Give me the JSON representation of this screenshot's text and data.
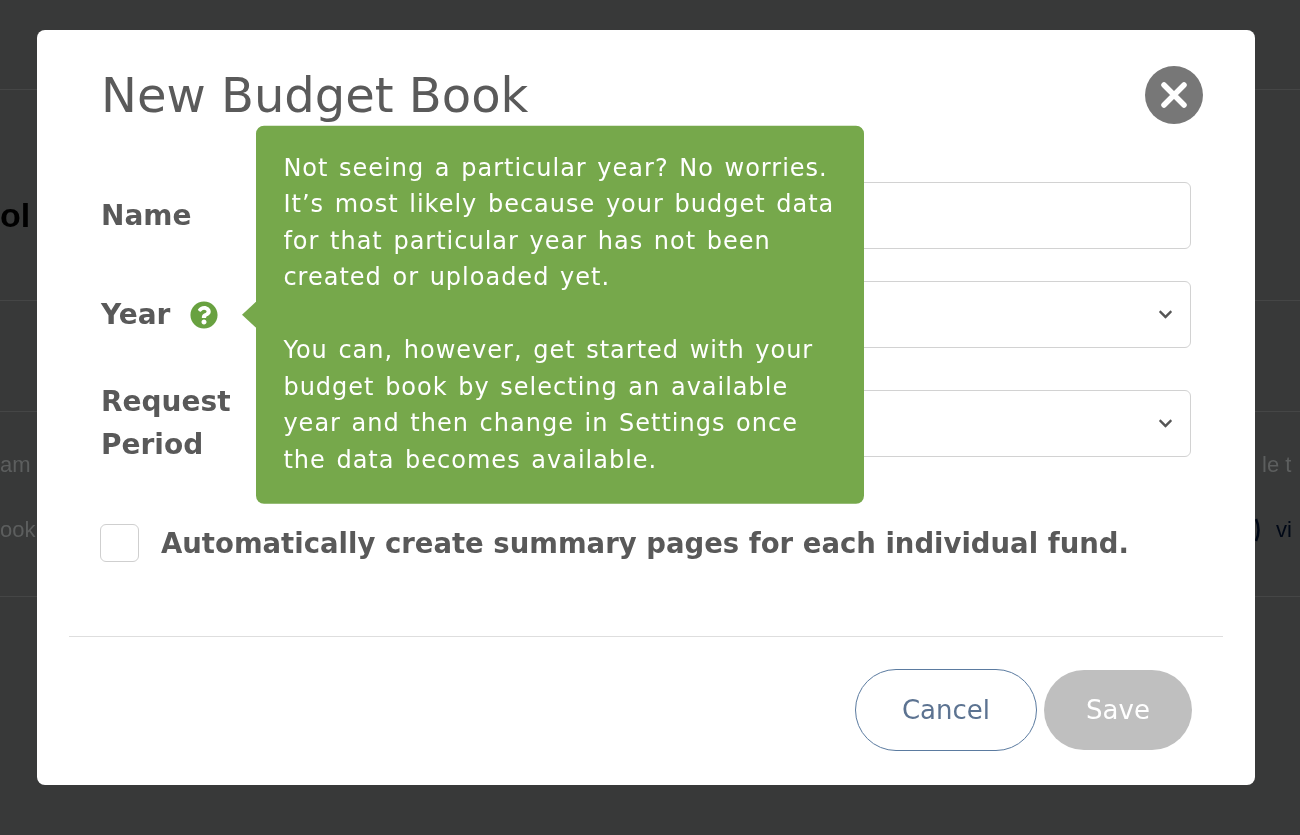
{
  "background_page": {
    "heading_fragment": "ol",
    "left_fragments": [
      "am",
      "ook"
    ],
    "right_fragments": [
      "le t",
      "vi"
    ]
  },
  "dialog": {
    "title": "New Budget Book",
    "fields": [
      {
        "kind": "text",
        "label": "Name"
      },
      {
        "kind": "select",
        "label": "Year",
        "tooltip": {
          "paragraphs": [
            [
              "Not seeing a particular year? No worries.",
              "It’s most likely because your budget data",
              "for that particular year has not been",
              "created or uploaded yet."
            ],
            [
              "You can, however, get started with your",
              "budget book by selecting an available",
              "year and then change in Settings once",
              "the data becomes available."
            ]
          ]
        }
      },
      {
        "kind": "select",
        "label": "Request Period"
      }
    ],
    "checkbox": {
      "label": "Automatically create summary pages for each individual fund.",
      "checked": false
    },
    "buttons": [
      {
        "kind": "secondary",
        "label": "Cancel",
        "disabled": false
      },
      {
        "kind": "primary",
        "label": "Save",
        "disabled": true
      }
    ]
  }
}
